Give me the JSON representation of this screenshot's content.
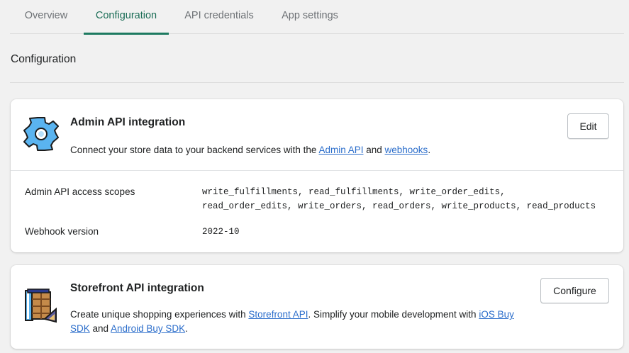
{
  "tabs": [
    {
      "label": "Overview"
    },
    {
      "label": "Configuration"
    },
    {
      "label": "API credentials"
    },
    {
      "label": "App settings"
    }
  ],
  "section": {
    "title": "Configuration"
  },
  "admin_card": {
    "title": "Admin API integration",
    "desc_prefix": "Connect your store data to your backend services with the ",
    "link1": "Admin API",
    "desc_mid": " and ",
    "link2": "webhooks",
    "desc_suffix": ".",
    "edit_label": "Edit",
    "scopes_label": "Admin API access scopes",
    "scopes_line1": "write_fulfillments, read_fulfillments, write_order_edits,",
    "scopes_line2": "read_order_edits, write_orders, read_orders, write_products, read_products",
    "webhook_label": "Webhook version",
    "webhook_value": "2022-10",
    "icon": "gear-icon"
  },
  "storefront_card": {
    "title": "Storefront API integration",
    "desc_prefix": "Create unique shopping experiences with ",
    "link1": "Storefront API",
    "desc_mid": ". Simplify your mobile development with ",
    "link2": "iOS Buy SDK",
    "desc_mid2": " and ",
    "link3": "Android Buy SDK",
    "desc_suffix": ".",
    "configure_label": "Configure",
    "icon": "storefront-icon"
  },
  "colors": {
    "accent": "#1d7a60",
    "link": "#2c6ecb",
    "gear": "#5ab4f0"
  }
}
